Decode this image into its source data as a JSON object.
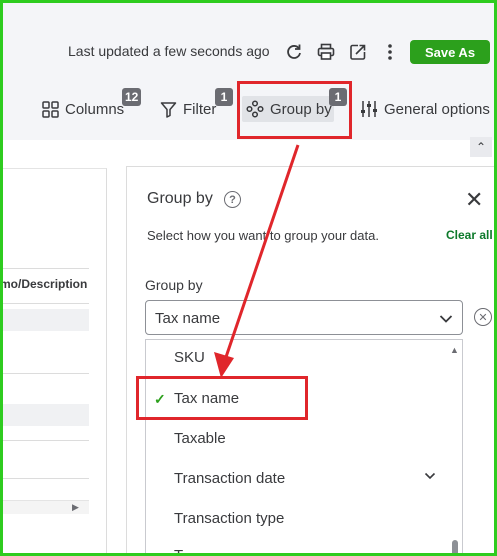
{
  "header": {
    "last_updated": "Last updated a few seconds ago",
    "save_as": "Save As",
    "icons": [
      "refresh-icon",
      "print-icon",
      "export-icon",
      "more-icon"
    ]
  },
  "toolbar": {
    "columns": {
      "label": "Columns",
      "badge": "12",
      "icon": "grid-icon"
    },
    "filter": {
      "label": "Filter",
      "badge": "1",
      "icon": "filter-icon"
    },
    "group_by": {
      "label": "Group by",
      "badge": "1",
      "icon": "group-icon"
    },
    "general_options": {
      "label": "General options",
      "icon": "sliders-icon"
    }
  },
  "table": {
    "visible_column_header": "mo/Description"
  },
  "group_panel": {
    "title": "Group by",
    "description": "Select how you want to group your data.",
    "clear_all": "Clear all",
    "field_label": "Group by",
    "selected_value": "Tax name",
    "options": [
      "SKU",
      "Tax name",
      "Taxable",
      "Transaction date",
      "Transaction type",
      "T"
    ],
    "checked_option": "Tax name"
  },
  "colors": {
    "accent_green": "#2ca01c",
    "annotation_red": "#e0262b",
    "frame_green": "#2ecc1f"
  }
}
